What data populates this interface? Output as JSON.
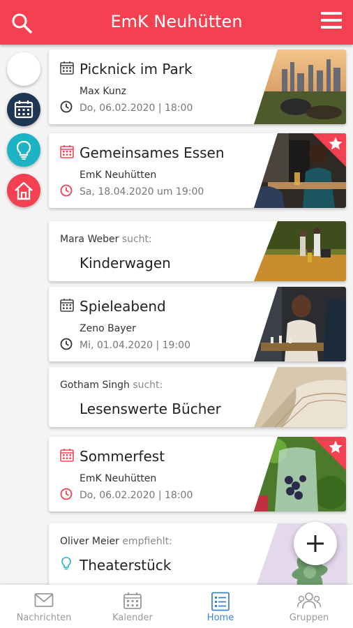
{
  "header": {
    "title": "EmK Neuhütten",
    "icons": {
      "left": "search-icon",
      "right": "menu-icon"
    }
  },
  "side_menu": {
    "items": [
      {
        "icon": "blank",
        "color": "#ffffff"
      },
      {
        "icon": "calendar-icon",
        "color": "#1f3554"
      },
      {
        "icon": "lightbulb-icon",
        "color": "#1cb4c4"
      },
      {
        "icon": "home-icon",
        "color": "#f44152"
      }
    ]
  },
  "feed": [
    {
      "kind": "event",
      "title": "Picknick im Park",
      "organizer": "Max Kunz",
      "datetime": "Do, 06.02.2020 | 18:00",
      "accent": "#333333",
      "favorite": false,
      "image": "park-skyline-photo"
    },
    {
      "kind": "event",
      "title": "Gemeinsames Essen",
      "organizer": "EmK Neuhütten",
      "datetime": "Sa, 18.04.2020 um 19:00",
      "accent": "#f44152",
      "favorite": true,
      "image": "dinner-photo"
    },
    {
      "kind": "search",
      "person": "Mara Weber",
      "verb": "sucht:",
      "item": "Kinderwagen",
      "image": "family-walk-photo"
    },
    {
      "kind": "event",
      "title": "Spieleabend",
      "organizer": "Zeno Bayer",
      "datetime": "Mi, 01.04.2020 | 19:00",
      "accent": "#333333",
      "favorite": false,
      "image": "chess-photo"
    },
    {
      "kind": "search",
      "person": "Gotham Singh",
      "verb": "sucht:",
      "item": "Lesenswerte Bücher",
      "image": "book-photo"
    },
    {
      "kind": "event",
      "title": "Sommerfest",
      "organizer": "EmK Neuhütten",
      "datetime": "Do, 06.02.2020 | 18:00",
      "accent": "#f44152",
      "favorite": true,
      "image": "berries-jar-photo"
    },
    {
      "kind": "recommend",
      "person": "Oliver Meier",
      "verb": "empfiehlt:",
      "item": "Theaterstück",
      "image": "succulent-photo"
    }
  ],
  "fab": {
    "icon": "plus-icon"
  },
  "bottom_nav": [
    {
      "label": "Nachrichten",
      "icon": "mail-icon",
      "active": false
    },
    {
      "label": "Kalender",
      "icon": "calendar-icon",
      "active": false
    },
    {
      "label": "Home",
      "icon": "list-icon",
      "active": true
    },
    {
      "label": "Gruppen",
      "icon": "group-icon",
      "active": false
    }
  ]
}
